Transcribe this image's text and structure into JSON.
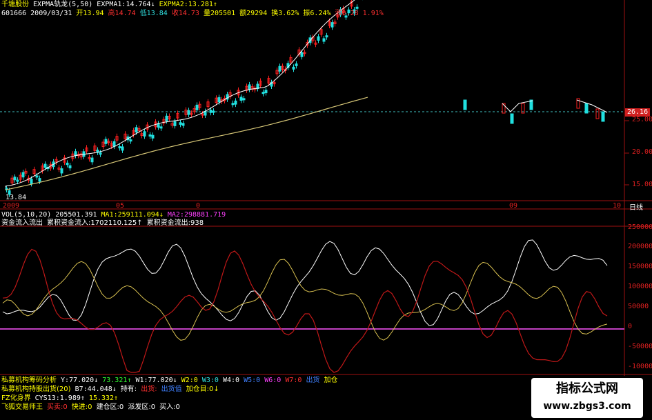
{
  "header": {
    "line1": {
      "stock_name": "千塘股份",
      "indicator": "EXPMA轨龙(5,50)",
      "expma1": "EXPMA1:14.764↓",
      "expma2": "EXPMA2:13.281↑"
    },
    "line2": {
      "code": "601666",
      "date": "2009/03/31",
      "open": "开13.94",
      "high": "高14.74",
      "low": "低13.84",
      "close": "收14.73",
      "volume": "量205501",
      "amount": "额29294",
      "turnover": "换3.62%",
      "amplitude": "振6.24%",
      "change": "涨0.28 1.91%"
    }
  },
  "price_axis": {
    "ticks": [
      "25.00",
      "20.00",
      "15.00"
    ],
    "current_price": "26.16"
  },
  "date_axis": {
    "labels": [
      "2009",
      "05",
      "0",
      "09",
      "10"
    ],
    "period": "日线",
    "low_marker": "13.84"
  },
  "volume_header": {
    "vol": "VOL(5,10,20)",
    "vol_value": "205501.391",
    "ma1": "MA1:259111.094↓",
    "ma2": "MA2:298881.719"
  },
  "fund_header": {
    "name": "资金流入流出",
    "inflow": "累积资金流入:1702110.125↑",
    "outflow": "累积资金流出:938"
  },
  "fund_axis": {
    "ticks": [
      "250000",
      "200000",
      "150000",
      "100000",
      "50000",
      "0",
      "-50000",
      "-100000"
    ]
  },
  "indicators": [
    {
      "name": "私募机构筹码分析",
      "values": [
        "Y:77.020↓",
        "73.321↑",
        "W1:77.020↓",
        "W2:0",
        "W3:0",
        "W4:0",
        "W5:0",
        "W6:0",
        "W7:0",
        "出货",
        "加仓"
      ]
    },
    {
      "name": "私募机构持股出货(20)",
      "values": [
        "B7:44.048↓",
        "持有:",
        "出货:",
        "出货值",
        "加仓目:0↓"
      ]
    },
    {
      "name": "FZ化身界",
      "values": [
        "CYS13:1.989↑",
        "15.332↑"
      ]
    },
    {
      "name": "飞狐交易师王",
      "values": [
        "买卖:0",
        "快进:0",
        "建仓区:0",
        "派发区:0",
        "买入:0"
      ]
    }
  ],
  "watermark": {
    "title": "指标公式网",
    "url": "www.zbgs3.com"
  },
  "colors": {
    "up": "#ff2020",
    "down": "#20e0e0",
    "ma_short": "#ffffff",
    "ma_long": "#d8c878",
    "fund_line1": "#ffffff",
    "fund_line2": "#d8c050",
    "fund_line3": "#c01818",
    "zero_line": "#c040c0",
    "grid_red": "#a01010"
  }
}
